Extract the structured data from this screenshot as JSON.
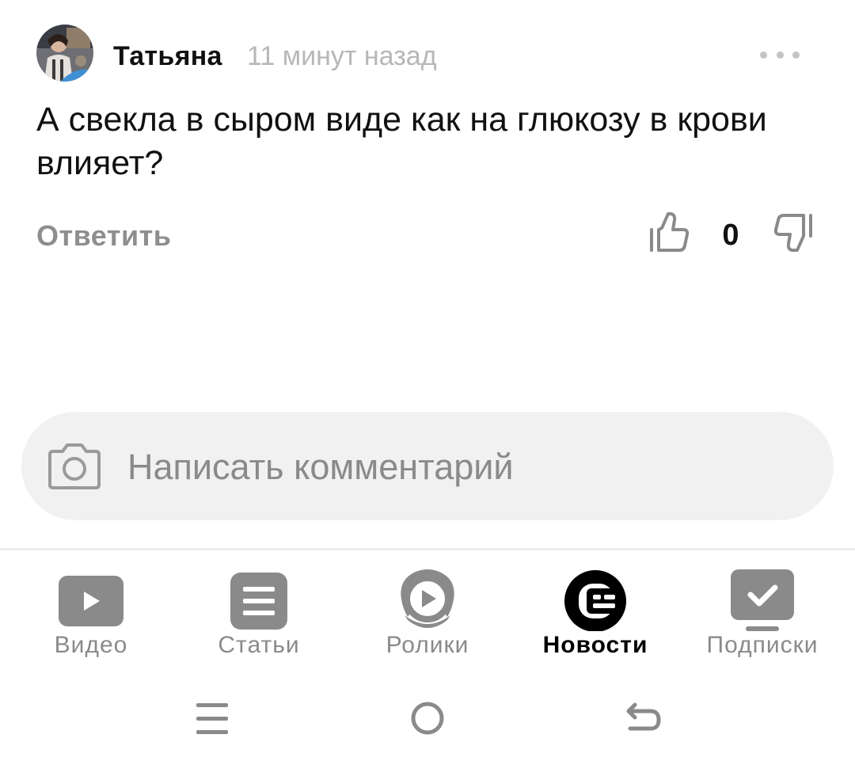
{
  "comment": {
    "author": "Татьяна",
    "time": "11 минут назад",
    "text": "А свекла в сыром виде как на глюкозу в крови влияет?",
    "reply_label": "Ответить",
    "score": "0",
    "more_icon": "more-dots-icon",
    "like_icon": "thumbs-up-icon",
    "dislike_icon": "thumbs-down-icon"
  },
  "composer": {
    "placeholder": "Написать комментарий",
    "camera_icon": "camera-icon"
  },
  "tabs": [
    {
      "label": "Видео",
      "icon": "video-play-icon",
      "active": false
    },
    {
      "label": "Статьи",
      "icon": "articles-icon",
      "active": false
    },
    {
      "label": "Ролики",
      "icon": "clips-icon",
      "active": false
    },
    {
      "label": "Новости",
      "icon": "news-icon",
      "active": true
    },
    {
      "label": "Подписки",
      "icon": "subscriptions-icon",
      "active": false
    }
  ],
  "system_nav": {
    "menu_icon": "menu-icon",
    "home_icon": "home-circle-icon",
    "back_icon": "back-arrow-icon"
  },
  "colors": {
    "icon_gray": "#8a8a8a",
    "active": "#000000",
    "composer_bg": "#f1f1f1"
  }
}
